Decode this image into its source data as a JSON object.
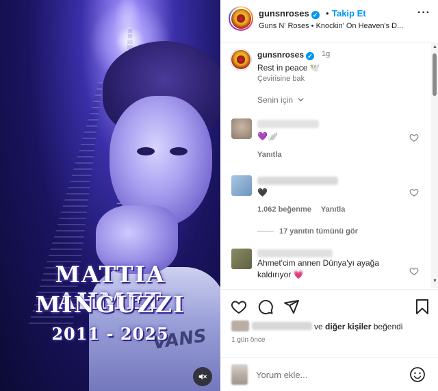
{
  "media": {
    "caption_line1": "MATTIA AHMET",
    "caption_line2": "MINGUZZI",
    "caption_line3": "2011 - 2025",
    "shirt_text": "VANS",
    "mute_icon": "speaker-muted-icon"
  },
  "header": {
    "username": "gunsnroses",
    "verified_icon": "verified-badge-icon",
    "separator": "•",
    "follow_label": "Takip Et",
    "more_icon": "more-options-icon",
    "subtitle": "Guns N' Roses • Knockin' On Heaven's D..."
  },
  "caption": {
    "username": "gunsnroses",
    "time": "1g",
    "text": "Rest in peace 🕊️",
    "translate_label": "Çevirisine bak"
  },
  "sort": {
    "label": "Senin için"
  },
  "comments": [
    {
      "text": "💜🪽",
      "reply_label": "Yanıtla"
    },
    {
      "text": "🖤",
      "likes": "1.062 beğenme",
      "reply_label": "Yanıtla",
      "view_replies": "17 yanıtın tümünü gör"
    },
    {
      "text": "Ahmet'cim annen Dünya'yı ayağa kaldırıyor 💗"
    }
  ],
  "actions": {
    "like_icon": "heart-icon",
    "comment_icon": "comment-icon",
    "share_icon": "share-icon",
    "save_icon": "bookmark-icon"
  },
  "likes": {
    "connector": "ve",
    "others": "diğer kişiler",
    "suffix": "beğendi"
  },
  "time_ago": "1 gün önce",
  "add_comment": {
    "placeholder": "Yorum ekle...",
    "emoji_icon": "emoji-icon"
  },
  "colors": {
    "accent_blue": "#0095f6",
    "heart_pink": "#ed4956",
    "text_secondary": "#737373"
  }
}
